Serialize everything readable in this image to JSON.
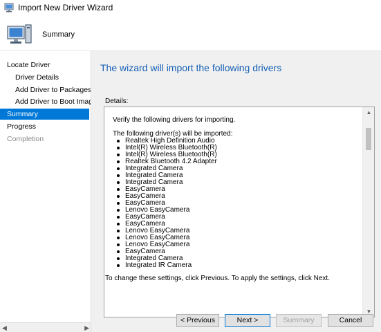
{
  "window": {
    "title": "Import New Driver Wizard"
  },
  "header": {
    "title": "Summary"
  },
  "sidebar": {
    "items": [
      {
        "label": "Locate Driver",
        "state": "normal"
      },
      {
        "label": "Driver Details",
        "state": "normal"
      },
      {
        "label": "Add Driver to Packages",
        "state": "normal"
      },
      {
        "label": "Add Driver to Boot Image",
        "state": "normal"
      },
      {
        "label": "Summary",
        "state": "active"
      },
      {
        "label": "Progress",
        "state": "normal"
      },
      {
        "label": "Completion",
        "state": "disabled"
      }
    ]
  },
  "main": {
    "heading": "The wizard will import the following drivers",
    "details_label": "Details:",
    "verify_text": "Verify the following drivers for importing.",
    "imported_heading": "The following driver(s) will be imported:",
    "drivers": [
      "Realtek High Definition Audio",
      "Intel(R) Wireless Bluetooth(R)",
      "Intel(R) Wireless Bluetooth(R)",
      "Realtek Bluetooth 4.2 Adapter",
      "Integrated Camera",
      "Integrated Camera",
      "Integrated Camera",
      "EasyCamera",
      "EasyCamera",
      "EasyCamera",
      "Lenovo EasyCamera",
      "EasyCamera",
      "EasyCamera",
      "Lenovo EasyCamera",
      "Lenovo EasyCamera",
      "Lenovo EasyCamera",
      "EasyCamera",
      "Integrated Camera",
      "Integrated IR Camera"
    ],
    "footer_note": "To change these settings, click Previous. To apply the settings, click Next."
  },
  "buttons": {
    "previous": "< Previous",
    "next": "Next >",
    "summary": "Summary",
    "cancel": "Cancel"
  },
  "colors": {
    "accent": "#0078d7",
    "heading": "#1660b6"
  }
}
